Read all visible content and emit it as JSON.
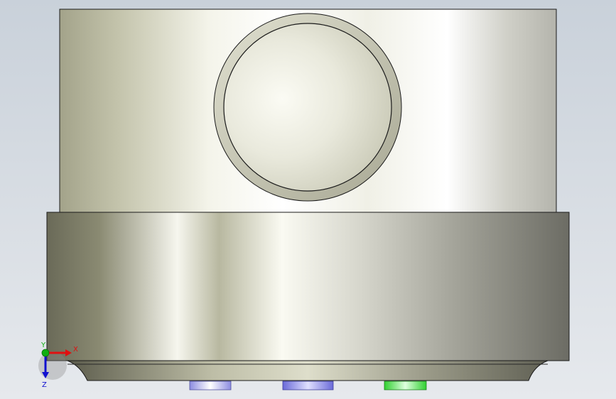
{
  "viewport": {
    "background_top": "#c9d1da",
    "background_bottom": "#e6e9ed"
  },
  "model": {
    "upper_cylinder_color": "#e8e9dc",
    "lower_ring_color": "#b9baa9",
    "outline_color": "#1a1a1a"
  },
  "triad": {
    "x_label": "X",
    "y_label": "Y",
    "z_label": "Z",
    "x_color": "#e01010",
    "y_color": "#10b010",
    "z_color": "#1010d0"
  },
  "markers": [
    {
      "name": "left",
      "color": "#8c8ce0"
    },
    {
      "name": "center",
      "color": "#6a6ad8"
    },
    {
      "name": "right",
      "color": "#30d030"
    }
  ]
}
